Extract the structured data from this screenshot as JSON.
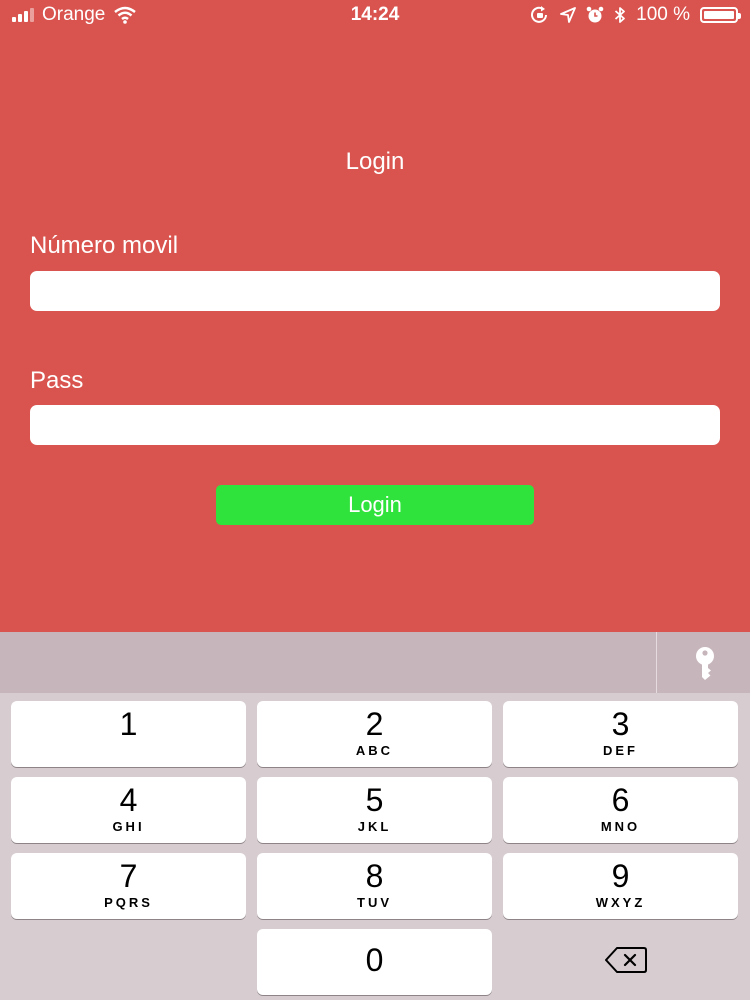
{
  "status_bar": {
    "carrier": "Orange",
    "time": "14:24",
    "battery_text": "100 %",
    "icons": [
      "signal-icon",
      "wifi-icon",
      "rotation-lock-icon",
      "location-arrow-icon",
      "alarm-icon",
      "bluetooth-icon",
      "battery-icon"
    ]
  },
  "screen": {
    "title": "Login",
    "fields": [
      {
        "label": "Número movil",
        "value": "",
        "placeholder": ""
      },
      {
        "label": "Pass",
        "value": "",
        "placeholder": ""
      }
    ],
    "login_button": "Login"
  },
  "keyboard": {
    "accessory_icon": "key-icon",
    "keys": [
      {
        "num": "1",
        "letters": ""
      },
      {
        "num": "2",
        "letters": "ABC"
      },
      {
        "num": "3",
        "letters": "DEF"
      },
      {
        "num": "4",
        "letters": "GHI"
      },
      {
        "num": "5",
        "letters": "JKL"
      },
      {
        "num": "6",
        "letters": "MNO"
      },
      {
        "num": "7",
        "letters": "PQRS"
      },
      {
        "num": "8",
        "letters": "TUV"
      },
      {
        "num": "9",
        "letters": "WXYZ"
      },
      {
        "num": "0",
        "letters": ""
      }
    ],
    "delete_icon": "backspace-icon"
  },
  "colors": {
    "background": "#d9544f",
    "login_button": "#2fe23c",
    "keyboard_bg": "#d7ccd0",
    "key_bg": "#ffffff"
  }
}
